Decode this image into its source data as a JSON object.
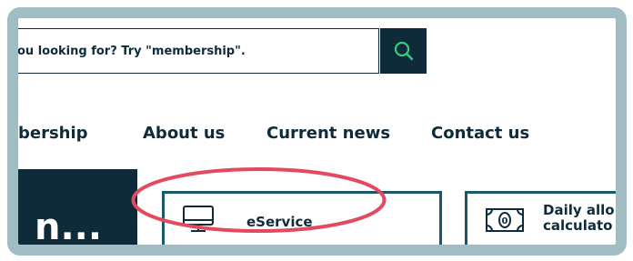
{
  "search": {
    "placeholder": "ou looking for? Try \"membership\"."
  },
  "nav": {
    "items": [
      {
        "label": "bership"
      },
      {
        "label": "About us"
      },
      {
        "label": "Current news"
      },
      {
        "label": "Contact us"
      }
    ]
  },
  "hero": {
    "partial_text": "n..."
  },
  "cards": {
    "eservice": {
      "label": "eService",
      "icon": "computer-monitor-icon"
    },
    "daily": {
      "label_line1": "Daily allo",
      "label_line2": "calculato",
      "icon": "money-banknote-icon"
    }
  },
  "colors": {
    "frame": "#9fbdc3",
    "navy": "#0f2b3a",
    "teal_border": "#17596a",
    "search_icon": "#2fd07a",
    "highlight": "#e24a5e"
  }
}
